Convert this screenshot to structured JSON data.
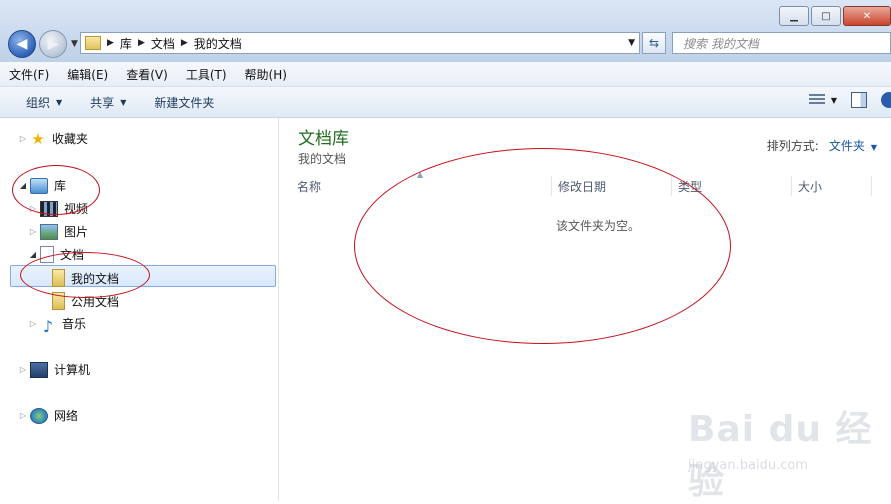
{
  "window": {
    "controls": [
      "minimize-icon",
      "maximize-icon",
      "close-icon"
    ]
  },
  "nav": {
    "back_icon": "back-arrow-icon",
    "forward_icon": "forward-arrow-icon",
    "breadcrumb": [
      "库",
      "文档",
      "我的文档"
    ],
    "search_placeholder": "搜索 我的文档"
  },
  "menubar": {
    "items": [
      "文件(F)",
      "编辑(E)",
      "查看(V)",
      "工具(T)",
      "帮助(H)"
    ]
  },
  "toolbar": {
    "organize": "组织",
    "share": "共享",
    "new_folder": "新建文件夹"
  },
  "sidebar": {
    "favorites": "收藏夹",
    "libraries": "库",
    "videos": "视频",
    "pictures": "图片",
    "documents": "文档",
    "my_documents": "我的文档",
    "public_documents": "公用文档",
    "music": "音乐",
    "computer": "计算机",
    "network": "网络"
  },
  "content": {
    "library_title": "文档库",
    "library_subtitle": "我的文档",
    "arrange_label": "排列方式:",
    "arrange_value": "文件夹",
    "columns": [
      "名称",
      "修改日期",
      "类型",
      "大小"
    ],
    "empty_message": "该文件夹为空。"
  },
  "annotation_color": "#c8101a",
  "watermark": {
    "brand": "Bai du 经验",
    "url": "jingyan.baidu.com"
  }
}
